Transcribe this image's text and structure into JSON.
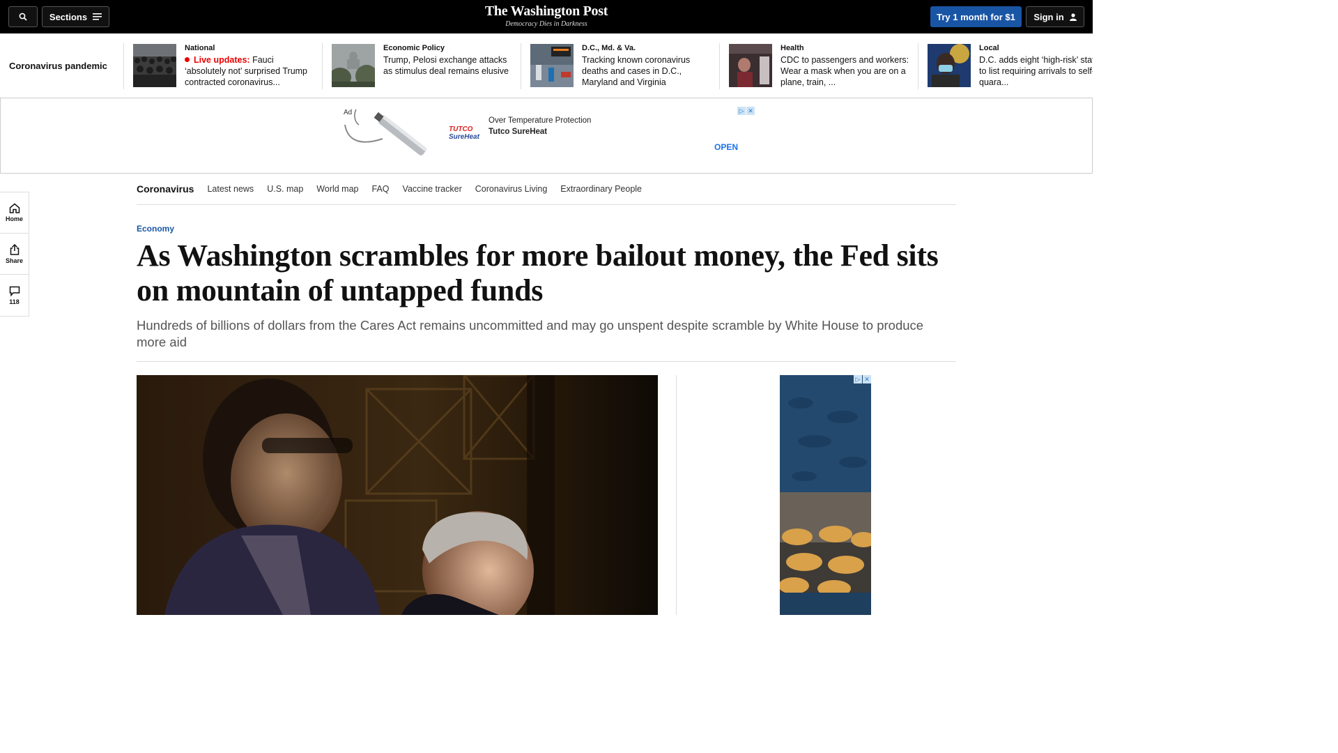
{
  "header": {
    "sections_label": "Sections",
    "logo": "The Washington Post",
    "tagline": "Democracy Dies in Darkness",
    "subscribe_label": "Try 1 month for $1",
    "signin_label": "Sign in"
  },
  "trending": {
    "title": "Coronavirus pandemic",
    "items": [
      {
        "kicker": "National",
        "live": "Live updates:",
        "headline": "Fauci ‘absolutely not’ surprised Trump contracted coronavirus..."
      },
      {
        "kicker": "Economic Policy",
        "headline": "Trump, Pelosi exchange attacks as stimulus deal remains elusive"
      },
      {
        "kicker": "D.C., Md. & Va.",
        "headline": "Tracking known coronavirus deaths and cases in D.C., Maryland and Virginia"
      },
      {
        "kicker": "Health",
        "headline": "CDC to passengers and workers: Wear a mask when you are on a plane, train, ..."
      },
      {
        "kicker": "Local",
        "headline": "D.C. adds eight ‘high-risk’ states to list requiring arrivals to self-quara..."
      }
    ]
  },
  "ad_banner": {
    "label": "Ad",
    "brand_top": "TUTCO",
    "brand_bottom": "SureHeat",
    "tagline": "Over Temperature Protection",
    "advertiser": "Tutco SureHeat",
    "cta": "OPEN"
  },
  "rail": {
    "home": "Home",
    "share": "Share",
    "comments": "118"
  },
  "subnav": {
    "title": "Coronavirus",
    "links": [
      "Latest news",
      "U.S. map",
      "World map",
      "FAQ",
      "Vaccine tracker",
      "Coronavirus Living",
      "Extraordinary People"
    ]
  },
  "article": {
    "kicker": "Economy",
    "title": "As Washington scrambles for more bailout money, the Fed sits on mountain of untapped funds",
    "dek": "Hundreds of billions of dollars from the Cares Act remains uncommitted and may go unspent despite scramble by White House to produce more aid"
  }
}
